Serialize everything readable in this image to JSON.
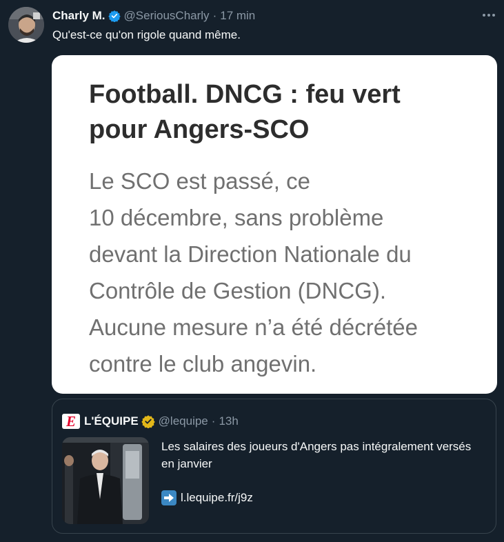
{
  "tweet": {
    "author": {
      "name": "Charly M.",
      "handle": "@SeriousCharly",
      "time": "17 min",
      "separator": "·"
    },
    "text": "Qu'est-ce qu'on rigole quand même.",
    "more_icon": "more-horizontal-icon",
    "media": {
      "title_lines": [
        "Football. DNCG : feu vert",
        "pour Angers-SCO"
      ],
      "lead_lines": [
        "Le SCO est passé, ce",
        "10 décembre, sans problème",
        "devant la Direction Nationale du",
        "Contrôle de Gestion (DNCG).",
        "Aucune mesure n’a été décrétée",
        "contre le club angevin."
      ]
    }
  },
  "quote": {
    "logo_text": "E",
    "name": "L'ÉQUIPE",
    "handle": "@lequipe",
    "separator": "·",
    "time": "13h",
    "text": "Les salaires des joueurs d'Angers pas intégralement versés en janvier",
    "link": "l.lequipe.fr/j9z",
    "link_icon": "right-arrow-icon"
  },
  "colors": {
    "background": "#15202b",
    "verified_blue": "#1d9bf0",
    "verified_gold": "#e2b719",
    "equipe_red": "#e4002b",
    "muted": "#8b98a5"
  }
}
